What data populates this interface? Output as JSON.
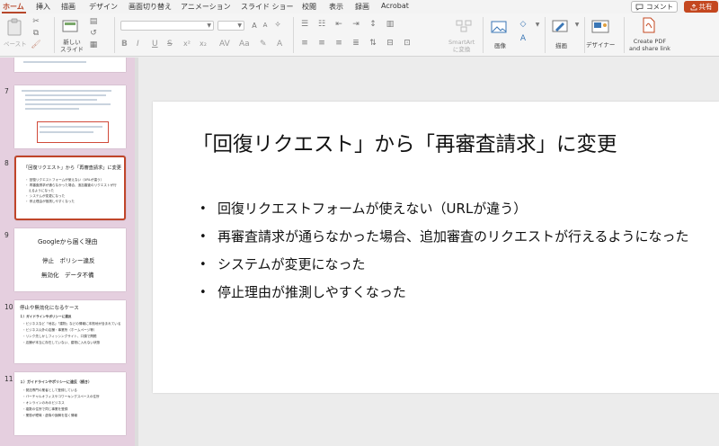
{
  "tabs": [
    "ホーム",
    "挿入",
    "描画",
    "デザイン",
    "画面切り替え",
    "アニメーション",
    "スライド ショー",
    "校閲",
    "表示",
    "録画",
    "Acrobat"
  ],
  "header": {
    "comment_label": "コメント",
    "share_label": "共有"
  },
  "ribbon": {
    "paste_label": "ペースト",
    "new_slide_label": "新しい\nスライド",
    "smartart_label": "SmartArt\nに変換",
    "image_label": "画像",
    "drawing_label": "描画",
    "designer_label": "デザイナー",
    "create_pdf_label": "Create PDF\nand share link",
    "bold": "B",
    "italic": "I",
    "underline": "U",
    "strike": "S"
  },
  "thumbnails": [
    {
      "number": "7"
    },
    {
      "number": "8",
      "title": "「回復リクエスト」から「再審査請求」に変更",
      "lines": [
        "・ 回復リクエストフォームが使えない（URLが違う）",
        "・ 再審査請求が通らなかった場合、追加審査のリクエストが行",
        "　えるようになった",
        "・ システムが変更になった",
        "・ 停止理由が推測しやすくなった"
      ]
    },
    {
      "number": "9",
      "title": "Googleから届く理由",
      "line1": "停止　ポリシー違反",
      "line2": "無効化　データ不備"
    },
    {
      "number": "10",
      "title": "停止や無効化になるケース",
      "subtitle": "１）ガイドラインやポリシーに違反",
      "lines": [
        "・ビジネスなど「地名」「建物」などの情報に本拠地が含まれている",
        "・ビジネス以外の店舗・事業所（ホームページ等）",
        "・リンク先しかしフィッシングサイト、口頭で問題",
        "・店舗が本当に存在していない、建物に入れない状態"
      ]
    },
    {
      "number": "11",
      "subtitle": "１）ガイドラインやポリシーに違反（続き）",
      "lines": [
        "・発送専門の業者として登録している",
        "・バーチャルオフィスやコワーキングスペースの住所",
        "・オンラインのみのビジネス",
        "・複数の住所で同じ事業を登録",
        "・業態が曖昧・虚偽や誤解を招く情報"
      ]
    }
  ],
  "slide": {
    "title": "「回復リクエスト」から「再審査請求」に変更",
    "bullets": [
      "回復リクエストフォームが使えない（URLが違う）",
      "再審査請求が通らなかった場合、追加審査のリクエストが行えるようになった",
      "システムが変更になった",
      "停止理由が推測しやすくなった"
    ]
  },
  "colors": {
    "accent": "#b7472a",
    "share": "#c4471f",
    "thumb_pane": "#e5cfdf"
  }
}
